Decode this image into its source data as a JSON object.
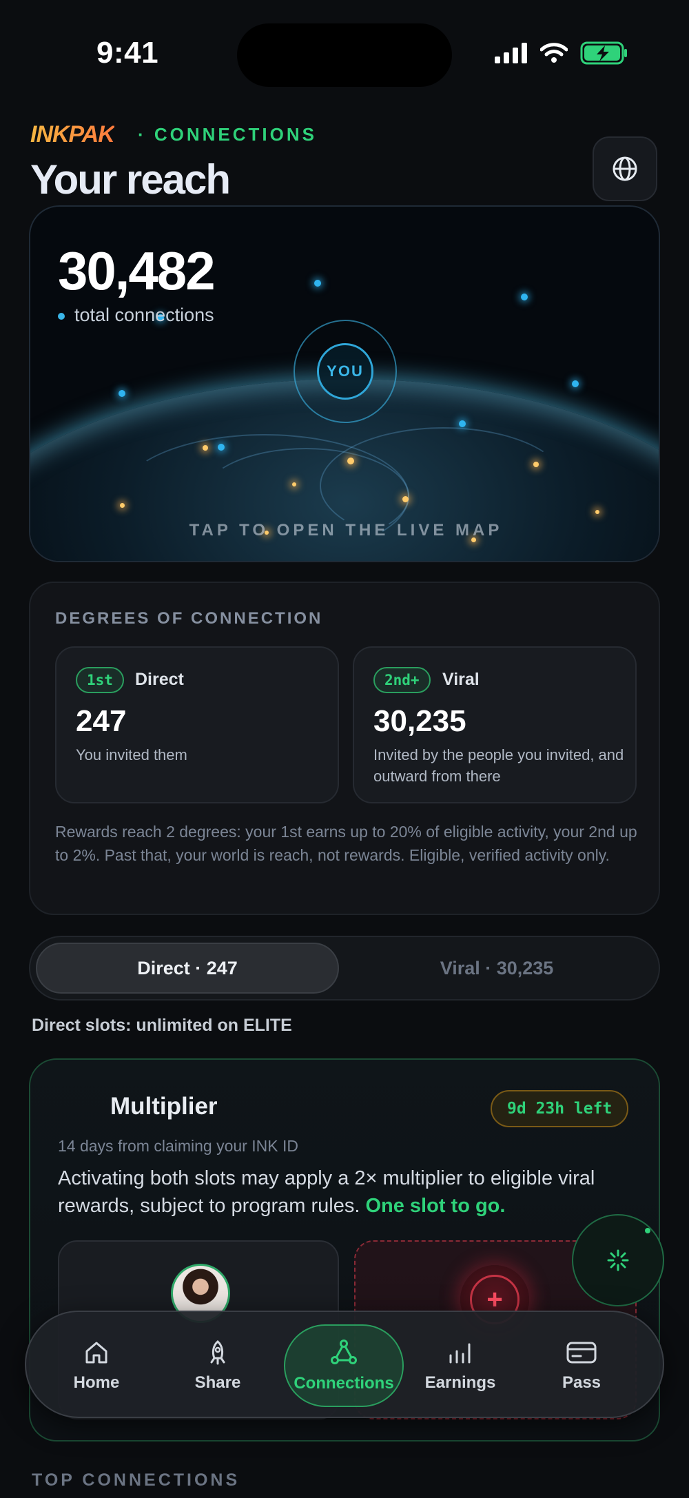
{
  "status_bar": {
    "time": "9:41"
  },
  "header": {
    "brand": "INKPAK",
    "section": "· CONNECTIONS",
    "title": "Your reach",
    "globe_icon": "globe-icon"
  },
  "reach_card": {
    "total": "30,482",
    "total_label": "total connections",
    "center_label": "YOU",
    "cta": "TAP TO OPEN THE LIVE MAP"
  },
  "degrees": {
    "heading": "DEGREES OF CONNECTION",
    "items": [
      {
        "badge": "1st",
        "name": "Direct",
        "value": "247",
        "description": "You invited them"
      },
      {
        "badge": "2nd+",
        "name": "Viral",
        "value": "30,235",
        "description": "Invited by the people you invited, and outward from there"
      }
    ],
    "footnote": "Rewards reach 2 degrees: your 1st earns up to 20% of eligible activity, your 2nd up to 2%. Past that, your world is reach, not rewards. Eligible, verified activity only."
  },
  "segment": {
    "options": [
      "Direct · 247",
      "Viral · 30,235"
    ],
    "selected": "Direct · 247"
  },
  "slots_note": "Direct slots: unlimited on ELITE",
  "multiplier": {
    "title": "Multiplier",
    "timer": "9d 23h left",
    "subtitle": "14 days from claiming your INK ID",
    "body": "Activating both slots may apply a 2× multiplier to eligible viral rewards, subject to program rules. ",
    "highlight": "One slot to go."
  },
  "tabbar": {
    "items": [
      {
        "label": "Home",
        "icon": "home-icon"
      },
      {
        "label": "Share",
        "icon": "rocket-icon"
      },
      {
        "label": "Connections",
        "icon": "network-icon"
      },
      {
        "label": "Earnings",
        "icon": "bar-chart-icon"
      },
      {
        "label": "Pass",
        "icon": "card-icon"
      }
    ],
    "active": "Connections"
  },
  "next_section": "TOP CONNECTIONS",
  "colors": {
    "accent": "#2fd27a",
    "info": "#3ab6e8",
    "warning": "#7a5a16",
    "danger": "#ff4d63"
  }
}
